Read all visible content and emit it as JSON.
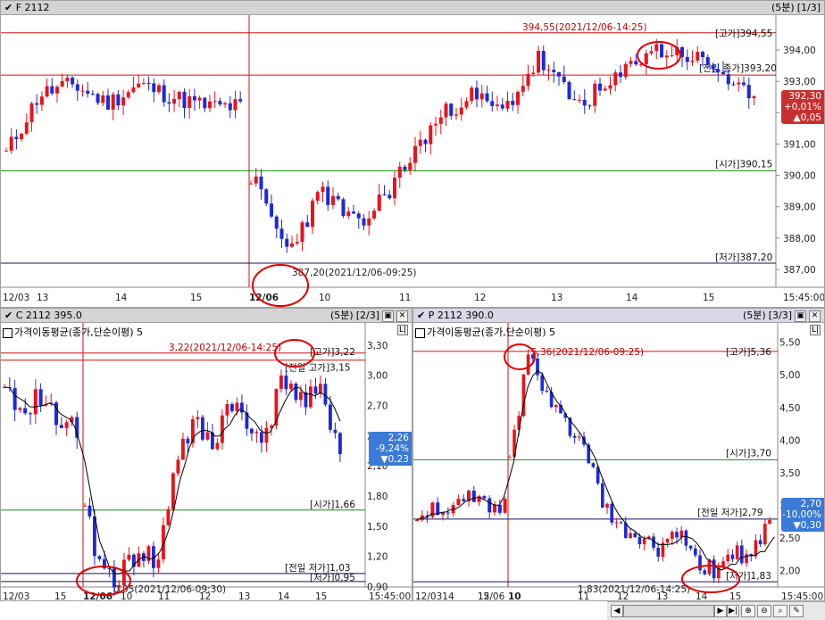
{
  "panes": {
    "f": {
      "title": "F 2112",
      "interval": "(5분)",
      "index": "[1/3]",
      "ticks": [
        "394,00",
        "393,00",
        "392,00",
        "391,00",
        "390,00",
        "389,00",
        "388,00",
        "387,00"
      ],
      "xlabels": [
        "12/03",
        "13",
        "14",
        "15",
        "12/06",
        "10",
        "11",
        "12",
        "13",
        "14",
        "15",
        "15:45:00"
      ],
      "high_label": "[고가]394,55",
      "open_label": "[시가]390,15",
      "low_label": "[저가]387,20",
      "prev_label": "[전일 종가]393,20",
      "high_note": "394,55(2021/12/06-14:25)",
      "low_note": "387,20(2021/12/06-09:25)",
      "badge": {
        "price": "392,30",
        "pct": "+0,01%",
        "chg": "▲0,05"
      }
    },
    "c": {
      "title": "C 2112 395.0",
      "interval": "(5분)",
      "index": "[2/3]",
      "ma": "가격이동평균(종가,단순이평) 5",
      "ticks": [
        "3,30",
        "3,00",
        "2,70",
        "2,40",
        "2,10",
        "1,80",
        "1,50",
        "1,20",
        "0,90"
      ],
      "xlabels": [
        "12/03",
        "15",
        "12/06",
        "10",
        "11",
        "12",
        "13",
        "14",
        "15",
        "15:45:00"
      ],
      "high_label": "[고가]3,22",
      "prev_label": "[전일 고가]3,15",
      "open_label": "[시가]1,66",
      "prevlow_label": "[전일 저가]1,03",
      "low_label": "[저가]0,95",
      "high_note": "3,22(2021/12/06-14:25)",
      "low_note": "0,95(2021/12/06-09:30)",
      "badge": {
        "price": "2,26",
        "pct": "-9,24%",
        "chg": "▼0,23"
      }
    },
    "p": {
      "title": "P 2112 390.0",
      "interval": "(5분)",
      "index": "[3/3]",
      "ma": "가격이동평균(종가,단순이평) 5",
      "ticks": [
        "5,50",
        "5,00",
        "4,50",
        "4,00",
        "3,50",
        "3,00",
        "2,50",
        "2,00"
      ],
      "xlabels": [
        "12/0314",
        "15",
        "12/06",
        "10",
        "11",
        "12",
        "13",
        "14",
        "15",
        "15:45:00"
      ],
      "high_label": "[고가]5,36",
      "open_label": "[시가]3,70",
      "prevlow_label": "[전일 저가]2,79",
      "low_label": "[저가]1,83",
      "high_note": "5,36(2021/12/06-09:25)",
      "low_note": "1,83(2021/12/06-14:25)",
      "badge": {
        "price": "2,70",
        "pct": "-10,00%",
        "chg": "▼0,30"
      }
    }
  },
  "colors": {
    "up": "#e8141c",
    "down": "#1c2ad8",
    "red_line": "#d01010",
    "green_line": "#109010",
    "navy_line": "#101060",
    "badge_up": "#c83030",
    "badge_down": "#3a7ad8"
  },
  "icons": [
    "check-icon",
    "restore-icon",
    "close-icon",
    "zoom-in-icon",
    "zoom-out-icon",
    "search-icon",
    "wrench-icon"
  ]
}
